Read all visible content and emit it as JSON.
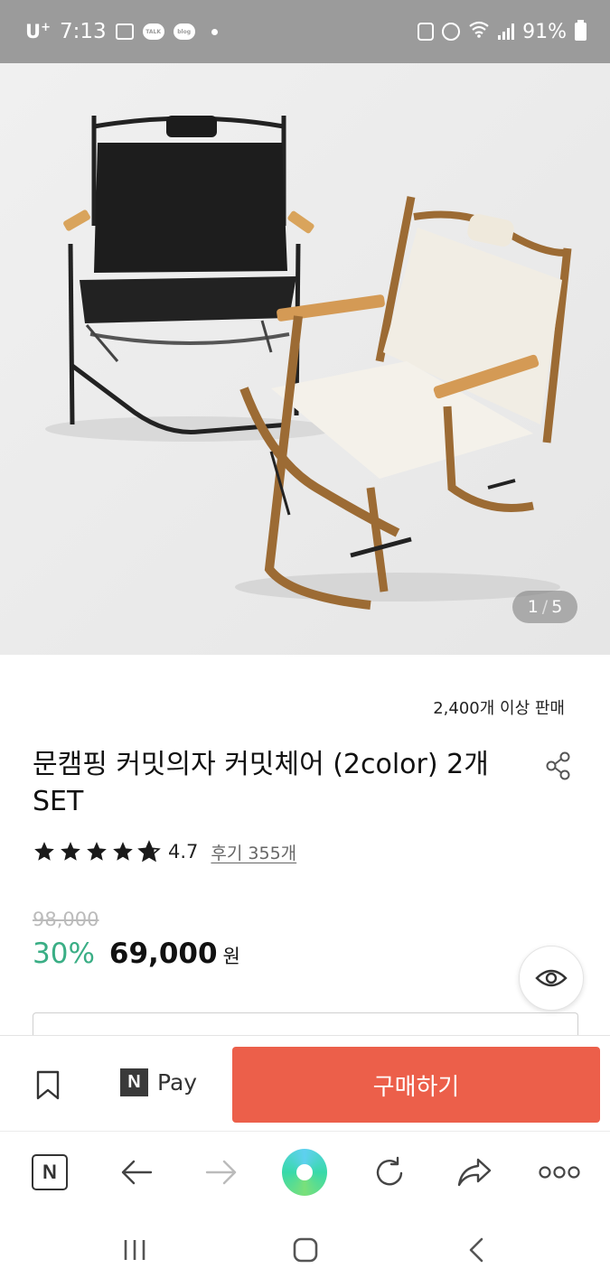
{
  "status_bar": {
    "carrier": "U",
    "carrier_sup": "+",
    "time": "7:13",
    "talk_badge": "TALK",
    "blog_badge": "blog",
    "battery_text": "91%"
  },
  "product": {
    "image_counter": {
      "current": "1",
      "separator": "/",
      "total": "5"
    },
    "sales_text": "2,400개 이상 판매",
    "title": "문캠핑 커밋의자 커밋체어 (2color) 2개 SET",
    "rating": {
      "stars": 4.7,
      "value": "4.7",
      "review_link": "후기 355개"
    },
    "original_price": "98,000",
    "discount": "30%",
    "price": "69,000",
    "currency": "원"
  },
  "buy_bar": {
    "npay_logo": "N",
    "npay_label": "Pay",
    "buy_label": "구매하기",
    "buy_color": "#ec5f4a"
  },
  "browser_bar": {
    "home_logo": "N"
  },
  "icons": {
    "share": "share-icon",
    "eye": "eye-icon",
    "bookmark": "bookmark-icon",
    "back": "arrow-left-icon",
    "forward": "arrow-right-icon",
    "reload": "reload-icon",
    "forward_share": "share-forward-icon",
    "more": "more-dots-icon"
  },
  "colors": {
    "discount": "#3aae85",
    "accent": "#ec5f4a",
    "star": "#1a1a1a"
  }
}
